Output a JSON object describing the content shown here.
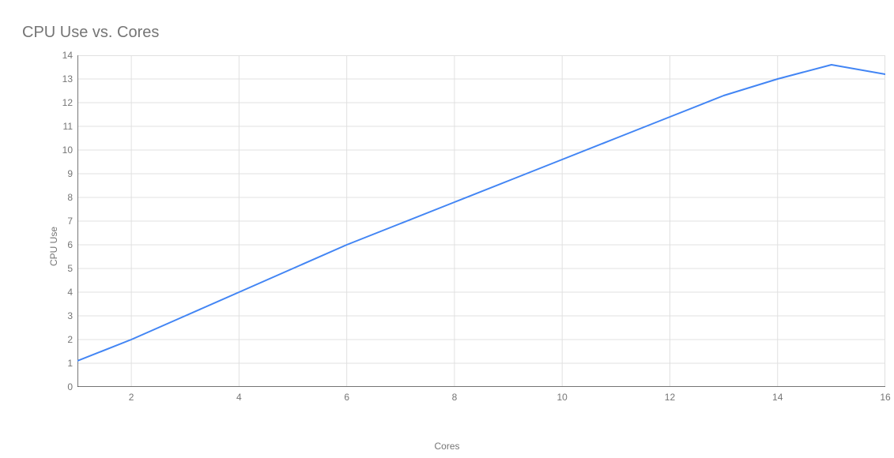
{
  "chart_data": {
    "type": "line",
    "title": "CPU Use vs. Cores",
    "xlabel": "Cores",
    "ylabel": "CPU Use",
    "xlim": [
      1,
      16
    ],
    "ylim": [
      0,
      14
    ],
    "x_ticks": [
      2,
      4,
      6,
      8,
      10,
      12,
      14,
      16
    ],
    "y_ticks": [
      0,
      1,
      2,
      3,
      4,
      5,
      6,
      7,
      8,
      9,
      10,
      11,
      12,
      13,
      14
    ],
    "x": [
      1,
      2,
      3,
      4,
      5,
      6,
      7,
      8,
      9,
      10,
      11,
      12,
      13,
      14,
      15,
      16
    ],
    "values": [
      1.1,
      2.0,
      3.0,
      4.0,
      5.0,
      6.0,
      6.9,
      7.8,
      8.7,
      9.6,
      10.5,
      11.4,
      12.3,
      13.0,
      13.6,
      13.2
    ],
    "line_color": "#4285f4",
    "grid_color": "#e0e0e0",
    "axis_color": "#333333"
  }
}
